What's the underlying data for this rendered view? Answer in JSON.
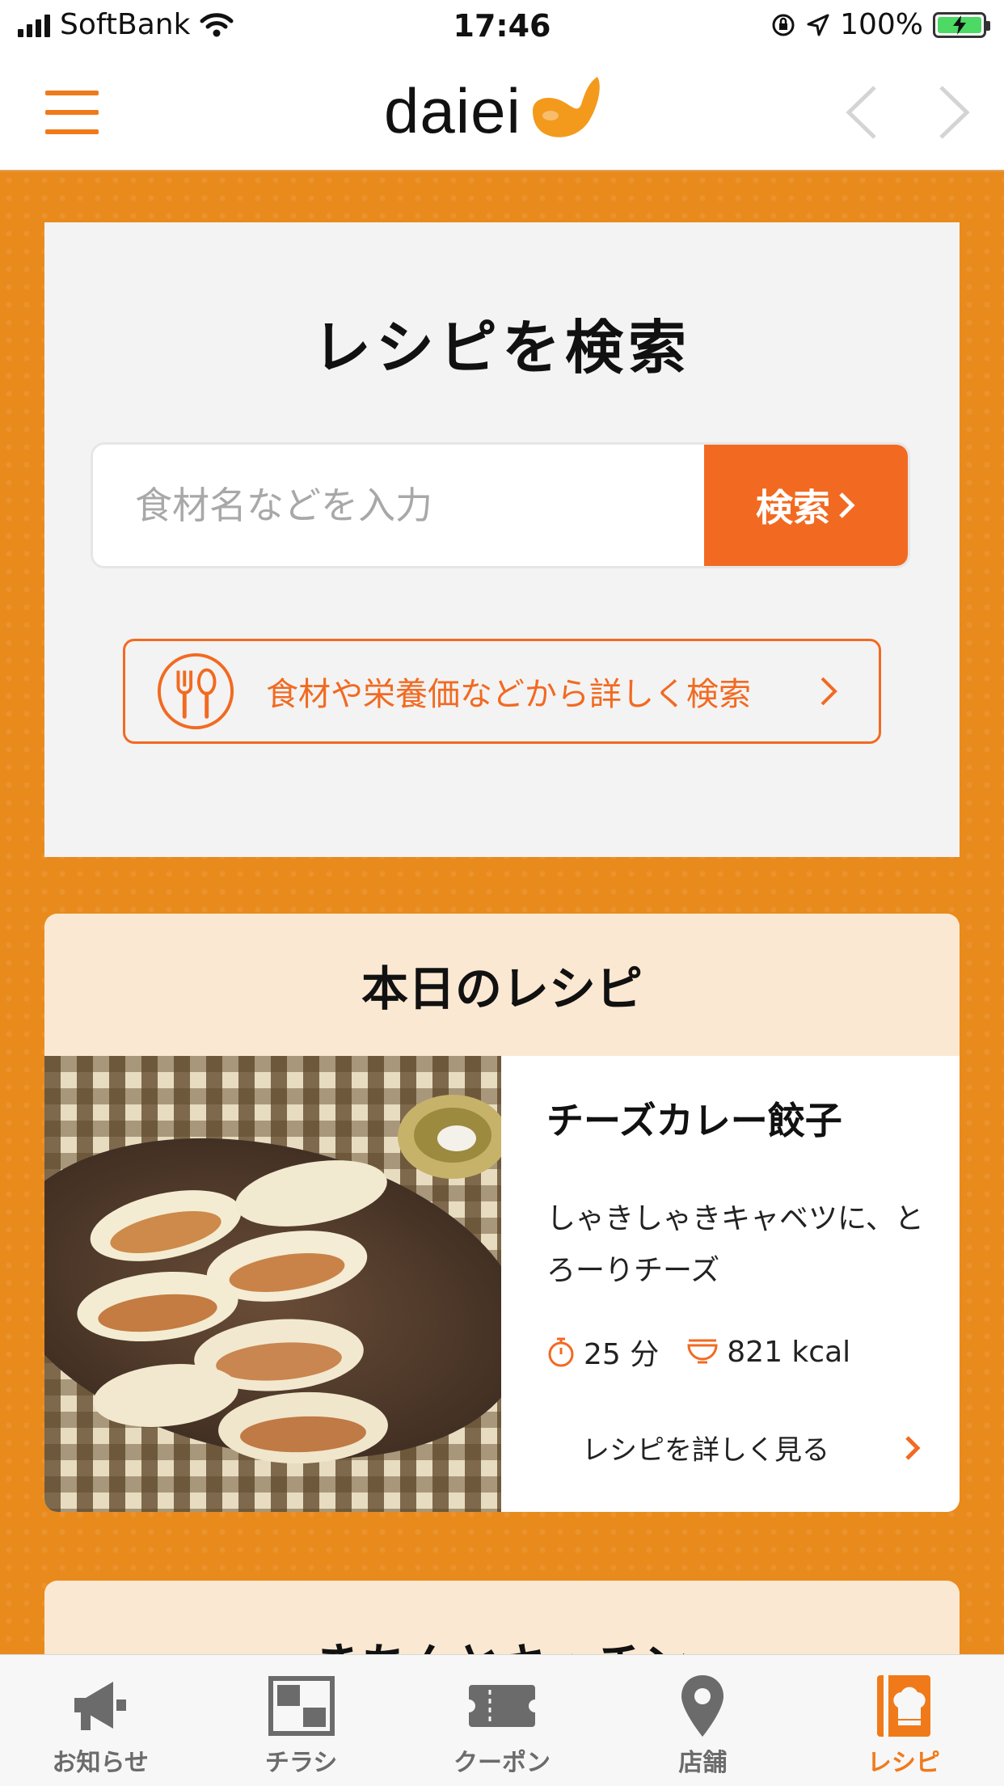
{
  "status_bar": {
    "carrier": "SoftBank",
    "time": "17:46",
    "battery_percent": "100%",
    "icons": [
      "signal-icon",
      "wifi-icon",
      "orientation-lock-icon",
      "location-arrow-icon",
      "battery-charging-icon"
    ]
  },
  "header": {
    "logo_text": "daiei",
    "menu_icon": "hamburger-icon",
    "back_icon": "chevron-left-icon",
    "forward_icon": "chevron-right-icon"
  },
  "search": {
    "title": "レシピを検索",
    "placeholder": "食材名などを入力",
    "button_label": "検索",
    "advanced_label": "食材や栄養価などから詳しく検索",
    "advanced_icon": "fork-spoon-icon"
  },
  "today_recipe": {
    "heading": "本日のレシピ",
    "name": "チーズカレー餃子",
    "description": "しゃきしゃきキャベツに、とろーりチーズ",
    "time_value": "25 分",
    "calories_value": "821 kcal",
    "link_label": "レシピを詳しく見る",
    "image": "gyoza-photo"
  },
  "next_section": {
    "heading": "きちんとキッチン"
  },
  "tabbar": {
    "active": "recipe",
    "tabs": [
      {
        "label": "お知らせ",
        "icon": "megaphone-icon"
      },
      {
        "label": "チラシ",
        "icon": "flyer-icon"
      },
      {
        "label": "クーポン",
        "icon": "ticket-icon"
      },
      {
        "label": "店舗",
        "icon": "map-pin-icon"
      },
      {
        "label": "レシピ",
        "icon": "chef-hat-icon"
      }
    ]
  },
  "colors": {
    "accent": "#f26a21",
    "brand_orange": "#e98a1c",
    "card_bg": "#f3f3f3",
    "recipe_header_bg": "#fbe8d2"
  }
}
